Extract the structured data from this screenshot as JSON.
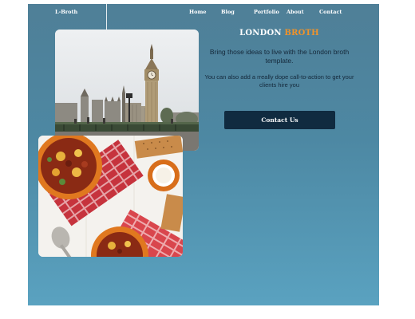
{
  "nav": {
    "brand": "L-Broth",
    "links": [
      "Home",
      "Blog",
      "Portfolio",
      "About",
      "Contact"
    ]
  },
  "hero": {
    "title_part1": "LONDON",
    "title_part2": "BROTH",
    "subtitle": "Bring those ideas to live with the London broth template.",
    "cta_text": "You can also add a rreally dope call-to-action to get your clients  hire you",
    "button_label": "Contact Us"
  },
  "images": {
    "top": "london-skyline-photo",
    "bottom": "food-bowls-photo"
  },
  "colors": {
    "background_top": "#4f7f97",
    "background_bottom": "#5aa2c0",
    "accent": "#f0932b",
    "button": "#102b40",
    "body_text": "#14283a"
  }
}
